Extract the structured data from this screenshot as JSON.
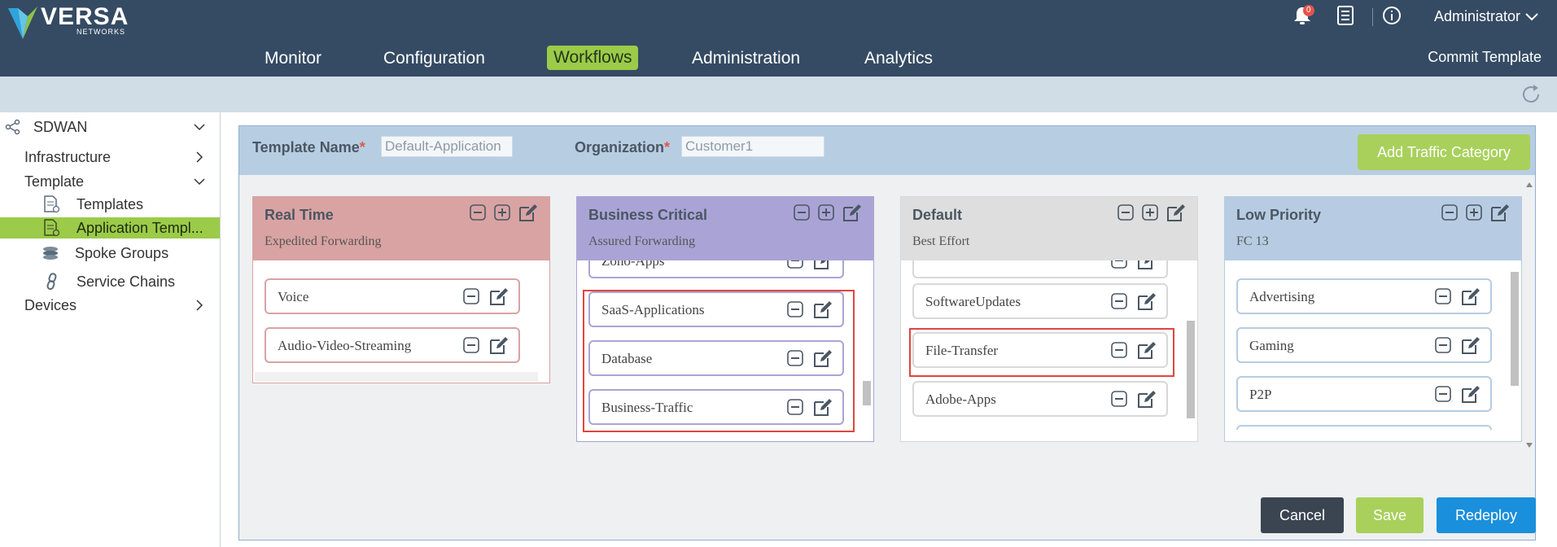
{
  "brand": {
    "name": "VERSA",
    "sub": "NETWORKS"
  },
  "nav": {
    "items": [
      "Monitor",
      "Configuration",
      "Workflows",
      "Administration",
      "Analytics"
    ],
    "active": "Workflows",
    "commit": "Commit Template"
  },
  "header": {
    "notification_count": "0",
    "user": "Administrator"
  },
  "sidebar": {
    "root": "SDWAN",
    "items": [
      "Infrastructure",
      "Template",
      "Templates",
      "Application Templ...",
      "Spoke Groups",
      "Service Chains",
      "Devices"
    ]
  },
  "form": {
    "template_name_label": "Template Name",
    "template_name_value": "Default-Application",
    "organization_label": "Organization",
    "organization_value": "Customer1",
    "required_mark": "*",
    "add_category": "Add Traffic Category"
  },
  "categories": [
    {
      "title": "Real Time",
      "subtitle": "Expedited Forwarding",
      "apps": [
        "Voice",
        "Audio-Video-Streaming"
      ]
    },
    {
      "title": "Business Critical",
      "subtitle": "Assured Forwarding",
      "apps": [
        "Zoho-Apps",
        "SaaS-Applications",
        "Database",
        "Business-Traffic"
      ]
    },
    {
      "title": "Default",
      "subtitle": "Best Effort",
      "apps": [
        "SoftwareUpdates",
        "File-Transfer",
        "Adobe-Apps"
      ]
    },
    {
      "title": "Low Priority",
      "subtitle": "FC 13",
      "apps": [
        "Advertising",
        "Gaming",
        "P2P"
      ]
    }
  ],
  "footer": {
    "cancel": "Cancel",
    "save": "Save",
    "redeploy": "Redeploy"
  },
  "colors": {
    "topbar": "#354b63",
    "accent": "#9bcb48",
    "realtime": "#d9a3a3",
    "business": "#aaa4d6",
    "default": "#d8d8d8",
    "low": "#b7cce2",
    "redeploy": "#1a8fdc",
    "cancel": "#3b4552"
  }
}
